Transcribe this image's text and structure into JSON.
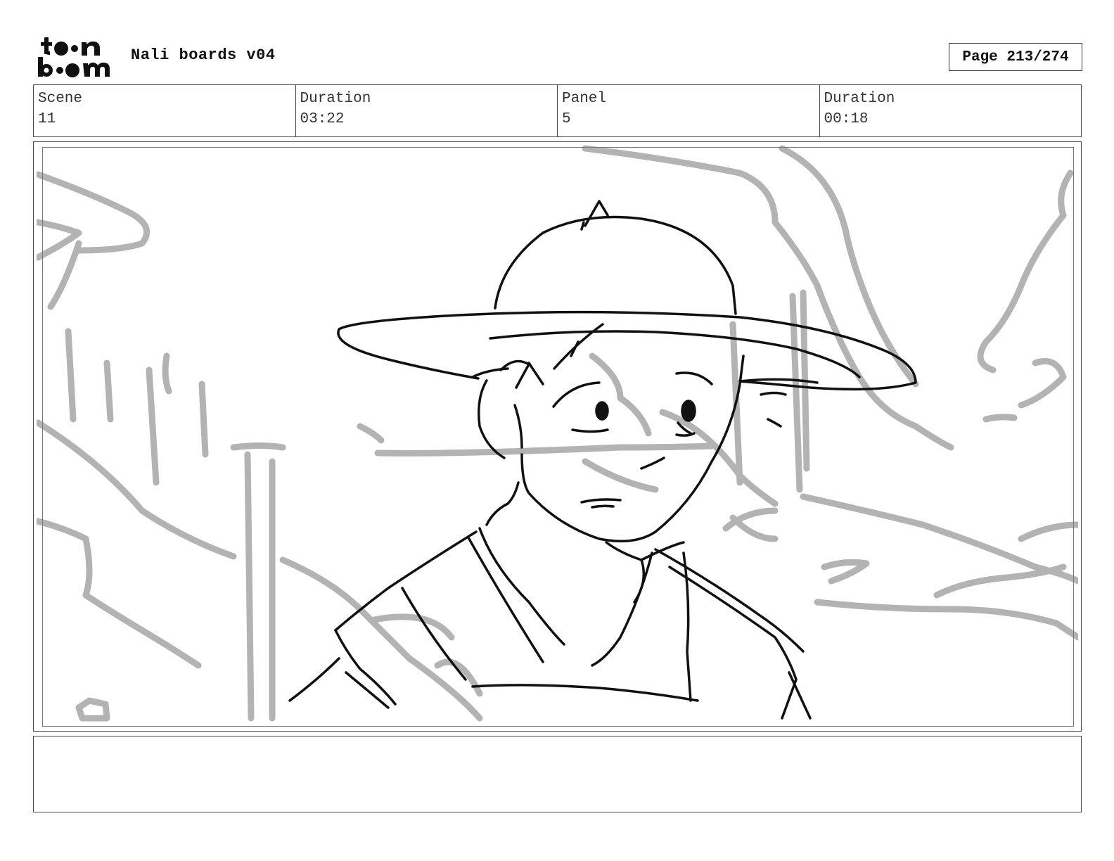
{
  "header": {
    "logo_text": "toonboom",
    "project_title": "Nali boards v04",
    "page_label": "Page 213/274"
  },
  "info": {
    "scene_label": "Scene",
    "scene_value": "11",
    "scene_duration_label": "Duration",
    "scene_duration_value": "03:22",
    "panel_label": "Panel",
    "panel_value": "5",
    "panel_duration_label": "Duration",
    "panel_duration_value": "00:18"
  },
  "notes": {
    "text": ""
  }
}
